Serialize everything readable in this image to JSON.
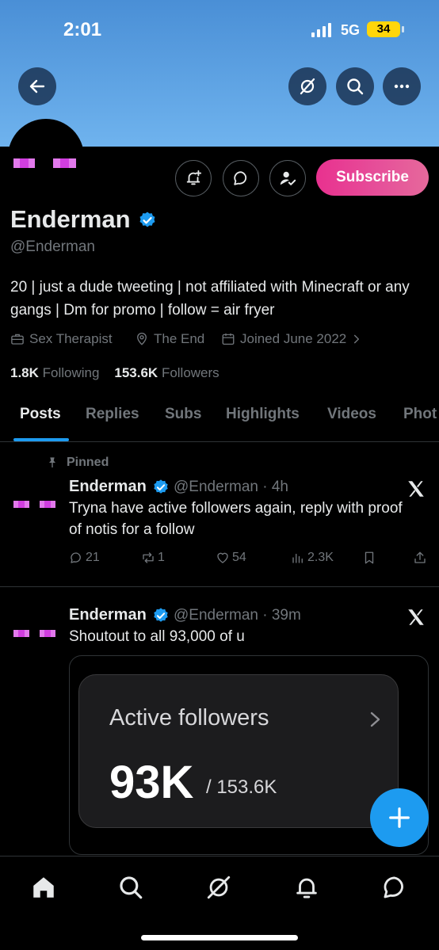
{
  "status_bar": {
    "time": "2:01",
    "network": "5G",
    "battery": "34"
  },
  "header": {
    "back_icon": "arrow-left-icon",
    "grok_icon": "grok-icon",
    "search_icon": "search-icon",
    "more_icon": "more-icon"
  },
  "profile": {
    "display_name": "Enderman",
    "verified": true,
    "handle": "@Enderman",
    "bio": "20 | just a dude tweeting | not affiliated with Minecraft or any gangs | Dm for promo | follow = air fryer",
    "profession": "Sex Therapist",
    "location": "The End",
    "joined": "Joined June 2022",
    "following_count": "1.8K",
    "following_label": "Following",
    "followers_count": "153.6K",
    "followers_label": "Followers",
    "subscribe_label": "Subscribe",
    "brand_color": "#1d9bf0"
  },
  "tabs": [
    {
      "label": "Posts",
      "active": true
    },
    {
      "label": "Replies",
      "active": false
    },
    {
      "label": "Subs",
      "active": false
    },
    {
      "label": "Highlights",
      "active": false
    },
    {
      "label": "Videos",
      "active": false
    },
    {
      "label": "Phot",
      "active": false
    }
  ],
  "posts": [
    {
      "pinned_label": "Pinned",
      "name": "Enderman",
      "handle": "@Enderman",
      "time": "4h",
      "text": "Tryna have active followers again, reply with proof of notis for a follow",
      "replies": "21",
      "reposts": "1",
      "likes": "54",
      "views": "2.3K"
    },
    {
      "name": "Enderman",
      "handle": "@Enderman",
      "time": "39m",
      "text": "Shoutout to all 93,000 of u",
      "media": {
        "title": "Active followers",
        "value": "93K",
        "total": "/ 153.6K"
      }
    }
  ],
  "bottom_nav": [
    "home-icon",
    "search-icon",
    "grok-icon",
    "bell-icon",
    "messages-icon"
  ]
}
